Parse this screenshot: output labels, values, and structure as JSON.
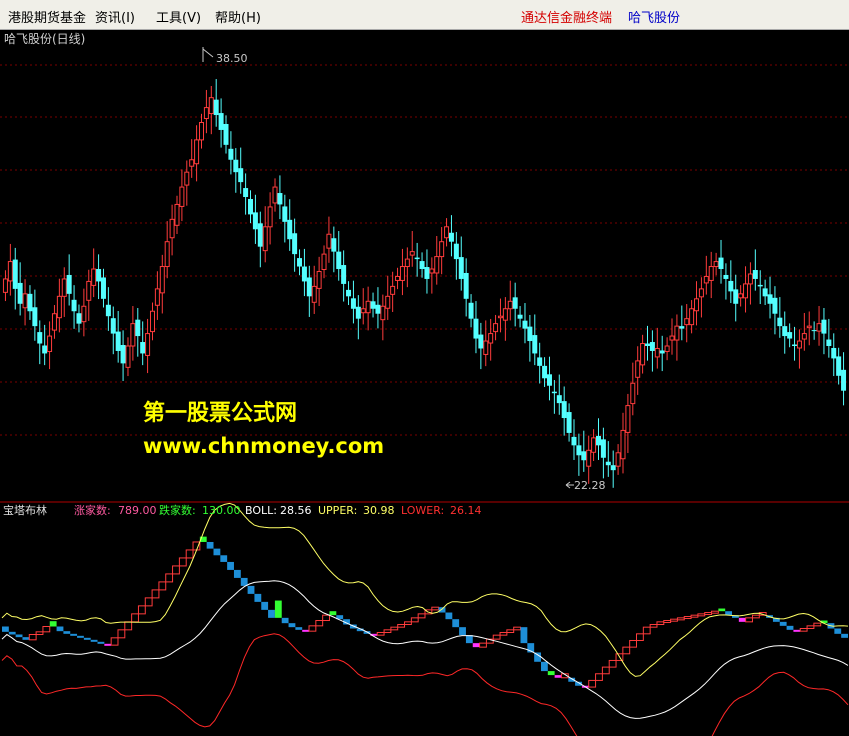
{
  "menu": {
    "items": [
      "港股期货基金",
      "资讯(I)",
      "工具(V)",
      "帮助(H)"
    ],
    "brand_label": "通达信金融终端",
    "brand_stock": "哈飞股份"
  },
  "main_chart": {
    "title": "哈飞股份(日线)",
    "price_high_label": "38.50",
    "price_low_label": "22.28"
  },
  "watermark": {
    "line1": "第一股票公式网",
    "line2": "www.chnmoney.com"
  },
  "indicator": {
    "name": "宝塔布林",
    "rise_label": "涨家数:",
    "rise_value": "789.00",
    "fall_label": "跌家数:",
    "fall_value": "130.00",
    "boll_label": "BOLL:",
    "boll_value": "28.56",
    "upper_label": "UPPER:",
    "upper_value": "30.98",
    "lower_label": "LOWER:",
    "lower_value": "26.14"
  },
  "colors": {
    "up": "#ff3c3c",
    "down": "#54ffff",
    "tower_up": "#ff3c3c",
    "tower_down": "#1e8fd8",
    "flip_green": "#33ff33",
    "flip_magenta": "#ff33ff",
    "upper": "#ffff66",
    "mid": "#ffffff",
    "lower": "#ff2828",
    "grid": "#7a0000"
  },
  "chart_data": {
    "type": "candlestick",
    "ylim": [
      21.5,
      39.5
    ],
    "closes": [
      30.2,
      30.9,
      29.8,
      29.2,
      29.6,
      28.9,
      28.3,
      27.6,
      27.2,
      27.9,
      28.8,
      29.5,
      30.2,
      29.6,
      28.9,
      28.4,
      29.1,
      30.1,
      30.6,
      30.1,
      29.4,
      28.7,
      28.0,
      27.3,
      26.8,
      27.5,
      28.4,
      27.9,
      27.2,
      28.0,
      28.9,
      29.8,
      30.7,
      31.7,
      32.6,
      33.2,
      33.9,
      34.5,
      35.0,
      35.8,
      36.5,
      37.1,
      37.5,
      36.8,
      36.2,
      35.6,
      35.0,
      34.5,
      34.1,
      33.5,
      32.8,
      32.2,
      31.5,
      32.3,
      33.1,
      33.9,
      33.2,
      32.5,
      31.8,
      31.2,
      30.7,
      30.1,
      29.5,
      29.9,
      30.5,
      31.2,
      32.0,
      31.3,
      30.6,
      30.0,
      29.5,
      29.0,
      28.6,
      29.0,
      29.3,
      29.0,
      28.8,
      29.1,
      29.5,
      29.9,
      30.3,
      30.7,
      31.0,
      31.3,
      31.0,
      30.6,
      30.2,
      30.6,
      31.1,
      31.7,
      32.3,
      31.7,
      31.0,
      30.2,
      29.4,
      28.6,
      27.8,
      27.4,
      27.7,
      28.0,
      28.4,
      28.7,
      29.0,
      29.3,
      29.0,
      28.6,
      28.2,
      27.7,
      27.2,
      26.7,
      26.2,
      25.9,
      25.6,
      25.2,
      24.6,
      24.0,
      23.5,
      23.1,
      22.9,
      23.3,
      23.8,
      23.5,
      23.0,
      22.7,
      22.5,
      23.2,
      24.1,
      25.1,
      26.0,
      26.9,
      27.6,
      27.5,
      27.3,
      27.4,
      27.2,
      27.5,
      27.9,
      28.3,
      28.2,
      28.6,
      29.0,
      29.4,
      29.8,
      30.3,
      30.7,
      30.9,
      30.6,
      30.2,
      29.7,
      29.2,
      29.6,
      30.0,
      30.4,
      30.2,
      29.9,
      29.5,
      29.2,
      28.8,
      28.3,
      27.9,
      27.8,
      27.5,
      27.7,
      28.0,
      28.3,
      28.1,
      28.4,
      28.0,
      27.5,
      27.0,
      26.3,
      25.7
    ],
    "tower": [
      {
        "b": 30.75,
        "t": 31.15,
        "c": "d"
      },
      {
        "b": 30.55,
        "t": 30.75,
        "c": "d"
      },
      {
        "b": 30.35,
        "t": 30.55,
        "c": "d"
      },
      {
        "b": 30.15,
        "t": 30.35,
        "c": "d"
      },
      {
        "b": 30.15,
        "t": 30.55,
        "c": "u"
      },
      {
        "b": 30.55,
        "t": 30.75,
        "c": "u"
      },
      {
        "b": 30.75,
        "t": 31.15,
        "c": "u"
      },
      {
        "b": 31.15,
        "t": 31.55,
        "c": "g"
      },
      {
        "b": 30.8,
        "t": 31.15,
        "c": "d"
      },
      {
        "b": 30.6,
        "t": 30.8,
        "c": "d"
      },
      {
        "b": 30.45,
        "t": 30.6,
        "c": "d"
      },
      {
        "b": 30.3,
        "t": 30.45,
        "c": "d"
      },
      {
        "b": 30.15,
        "t": 30.3,
        "c": "d"
      },
      {
        "b": 30.0,
        "t": 30.15,
        "c": "d"
      },
      {
        "b": 29.85,
        "t": 30.0,
        "c": "d"
      },
      {
        "b": 29.75,
        "t": 29.85,
        "c": "m"
      },
      {
        "b": 29.75,
        "t": 30.3,
        "c": "u"
      },
      {
        "b": 30.3,
        "t": 30.9,
        "c": "u"
      },
      {
        "b": 30.9,
        "t": 31.5,
        "c": "u"
      },
      {
        "b": 31.5,
        "t": 32.1,
        "c": "u"
      },
      {
        "b": 32.1,
        "t": 32.7,
        "c": "u"
      },
      {
        "b": 32.7,
        "t": 33.3,
        "c": "u"
      },
      {
        "b": 33.3,
        "t": 33.9,
        "c": "u"
      },
      {
        "b": 33.9,
        "t": 34.5,
        "c": "u"
      },
      {
        "b": 34.5,
        "t": 35.1,
        "c": "u"
      },
      {
        "b": 35.1,
        "t": 35.7,
        "c": "u"
      },
      {
        "b": 35.7,
        "t": 36.3,
        "c": "u"
      },
      {
        "b": 36.3,
        "t": 36.9,
        "c": "u"
      },
      {
        "b": 36.9,
        "t": 37.5,
        "c": "u"
      },
      {
        "b": 37.5,
        "t": 37.9,
        "c": "g"
      },
      {
        "b": 37.0,
        "t": 37.5,
        "c": "d"
      },
      {
        "b": 36.5,
        "t": 37.0,
        "c": "d"
      },
      {
        "b": 36.0,
        "t": 36.5,
        "c": "d"
      },
      {
        "b": 35.4,
        "t": 36.0,
        "c": "d"
      },
      {
        "b": 34.8,
        "t": 35.4,
        "c": "d"
      },
      {
        "b": 34.2,
        "t": 34.8,
        "c": "d"
      },
      {
        "b": 33.6,
        "t": 34.2,
        "c": "d"
      },
      {
        "b": 33.0,
        "t": 33.6,
        "c": "d"
      },
      {
        "b": 32.4,
        "t": 33.0,
        "c": "d"
      },
      {
        "b": 31.8,
        "t": 32.4,
        "c": "d"
      },
      {
        "b": 31.8,
        "t": 33.1,
        "c": "g"
      },
      {
        "b": 31.4,
        "t": 31.8,
        "c": "d"
      },
      {
        "b": 31.1,
        "t": 31.4,
        "c": "d"
      },
      {
        "b": 30.9,
        "t": 31.1,
        "c": "d"
      },
      {
        "b": 30.8,
        "t": 30.9,
        "c": "m"
      },
      {
        "b": 30.8,
        "t": 31.2,
        "c": "u"
      },
      {
        "b": 31.2,
        "t": 31.6,
        "c": "u"
      },
      {
        "b": 31.6,
        "t": 32.0,
        "c": "u"
      },
      {
        "b": 32.0,
        "t": 32.3,
        "c": "g"
      },
      {
        "b": 31.7,
        "t": 32.0,
        "c": "d"
      },
      {
        "b": 31.3,
        "t": 31.7,
        "c": "d"
      },
      {
        "b": 31.0,
        "t": 31.3,
        "c": "d"
      },
      {
        "b": 30.8,
        "t": 31.0,
        "c": "d"
      },
      {
        "b": 30.6,
        "t": 30.8,
        "c": "d"
      },
      {
        "b": 30.5,
        "t": 30.6,
        "c": "m"
      },
      {
        "b": 30.5,
        "t": 30.7,
        "c": "u"
      },
      {
        "b": 30.7,
        "t": 30.9,
        "c": "u"
      },
      {
        "b": 30.9,
        "t": 31.1,
        "c": "u"
      },
      {
        "b": 31.1,
        "t": 31.3,
        "c": "u"
      },
      {
        "b": 31.3,
        "t": 31.5,
        "c": "u"
      },
      {
        "b": 31.5,
        "t": 31.8,
        "c": "u"
      },
      {
        "b": 31.8,
        "t": 32.1,
        "c": "u"
      },
      {
        "b": 32.1,
        "t": 32.4,
        "c": "u"
      },
      {
        "b": 32.4,
        "t": 32.6,
        "c": "u"
      },
      {
        "b": 32.6,
        "t": 32.2,
        "c": "d"
      },
      {
        "b": 32.2,
        "t": 31.7,
        "c": "d"
      },
      {
        "b": 31.7,
        "t": 31.1,
        "c": "d"
      },
      {
        "b": 30.5,
        "t": 31.1,
        "c": "d"
      },
      {
        "b": 29.9,
        "t": 30.5,
        "c": "d"
      },
      {
        "b": 29.6,
        "t": 29.9,
        "c": "m"
      },
      {
        "b": 29.6,
        "t": 29.9,
        "c": "u"
      },
      {
        "b": 29.9,
        "t": 30.2,
        "c": "u"
      },
      {
        "b": 30.2,
        "t": 30.5,
        "c": "u"
      },
      {
        "b": 30.5,
        "t": 30.7,
        "c": "u"
      },
      {
        "b": 30.7,
        "t": 30.9,
        "c": "u"
      },
      {
        "b": 30.9,
        "t": 31.1,
        "c": "u"
      },
      {
        "b": 29.9,
        "t": 31.1,
        "c": "d"
      },
      {
        "b": 29.2,
        "t": 29.9,
        "c": "d"
      },
      {
        "b": 28.5,
        "t": 29.2,
        "c": "d"
      },
      {
        "b": 27.8,
        "t": 28.5,
        "c": "d"
      },
      {
        "b": 27.5,
        "t": 27.8,
        "c": "g"
      },
      {
        "b": 27.3,
        "t": 27.5,
        "c": "m"
      },
      {
        "b": 27.3,
        "t": 27.6,
        "c": "u"
      },
      {
        "b": 27.0,
        "t": 27.3,
        "c": "d"
      },
      {
        "b": 26.7,
        "t": 27.0,
        "c": "d"
      },
      {
        "b": 26.6,
        "t": 26.7,
        "c": "m"
      },
      {
        "b": 26.6,
        "t": 27.1,
        "c": "u"
      },
      {
        "b": 27.1,
        "t": 27.6,
        "c": "u"
      },
      {
        "b": 27.6,
        "t": 28.1,
        "c": "u"
      },
      {
        "b": 28.1,
        "t": 28.6,
        "c": "u"
      },
      {
        "b": 28.6,
        "t": 29.1,
        "c": "u"
      },
      {
        "b": 29.1,
        "t": 29.6,
        "c": "u"
      },
      {
        "b": 29.6,
        "t": 30.1,
        "c": "u"
      },
      {
        "b": 30.1,
        "t": 30.6,
        "c": "u"
      },
      {
        "b": 30.6,
        "t": 31.1,
        "c": "u"
      },
      {
        "b": 31.1,
        "t": 31.3,
        "c": "u"
      },
      {
        "b": 31.3,
        "t": 31.5,
        "c": "u"
      },
      {
        "b": 31.5,
        "t": 31.6,
        "c": "u"
      },
      {
        "b": 31.6,
        "t": 31.7,
        "c": "u"
      },
      {
        "b": 31.7,
        "t": 31.8,
        "c": "u"
      },
      {
        "b": 31.8,
        "t": 31.9,
        "c": "u"
      },
      {
        "b": 31.9,
        "t": 32.0,
        "c": "u"
      },
      {
        "b": 32.0,
        "t": 32.1,
        "c": "u"
      },
      {
        "b": 32.1,
        "t": 32.2,
        "c": "u"
      },
      {
        "b": 32.2,
        "t": 32.3,
        "c": "u"
      },
      {
        "b": 32.3,
        "t": 32.5,
        "c": "g"
      },
      {
        "b": 32.0,
        "t": 32.3,
        "c": "d"
      },
      {
        "b": 31.8,
        "t": 32.0,
        "c": "d"
      },
      {
        "b": 31.5,
        "t": 31.8,
        "c": "m"
      },
      {
        "b": 31.5,
        "t": 31.8,
        "c": "u"
      },
      {
        "b": 31.8,
        "t": 32.0,
        "c": "u"
      },
      {
        "b": 32.0,
        "t": 32.2,
        "c": "u"
      },
      {
        "b": 31.8,
        "t": 32.0,
        "c": "d"
      },
      {
        "b": 31.5,
        "t": 31.8,
        "c": "d"
      },
      {
        "b": 31.2,
        "t": 31.5,
        "c": "d"
      },
      {
        "b": 30.9,
        "t": 31.2,
        "c": "d"
      },
      {
        "b": 30.8,
        "t": 30.9,
        "c": "m"
      },
      {
        "b": 30.8,
        "t": 31.0,
        "c": "u"
      },
      {
        "b": 31.0,
        "t": 31.2,
        "c": "u"
      },
      {
        "b": 31.2,
        "t": 31.4,
        "c": "u"
      },
      {
        "b": 31.4,
        "t": 31.6,
        "c": "g"
      },
      {
        "b": 31.0,
        "t": 31.4,
        "c": "d"
      },
      {
        "b": 30.6,
        "t": 31.0,
        "c": "d"
      },
      {
        "b": 30.3,
        "t": 30.6,
        "c": "d"
      }
    ]
  }
}
